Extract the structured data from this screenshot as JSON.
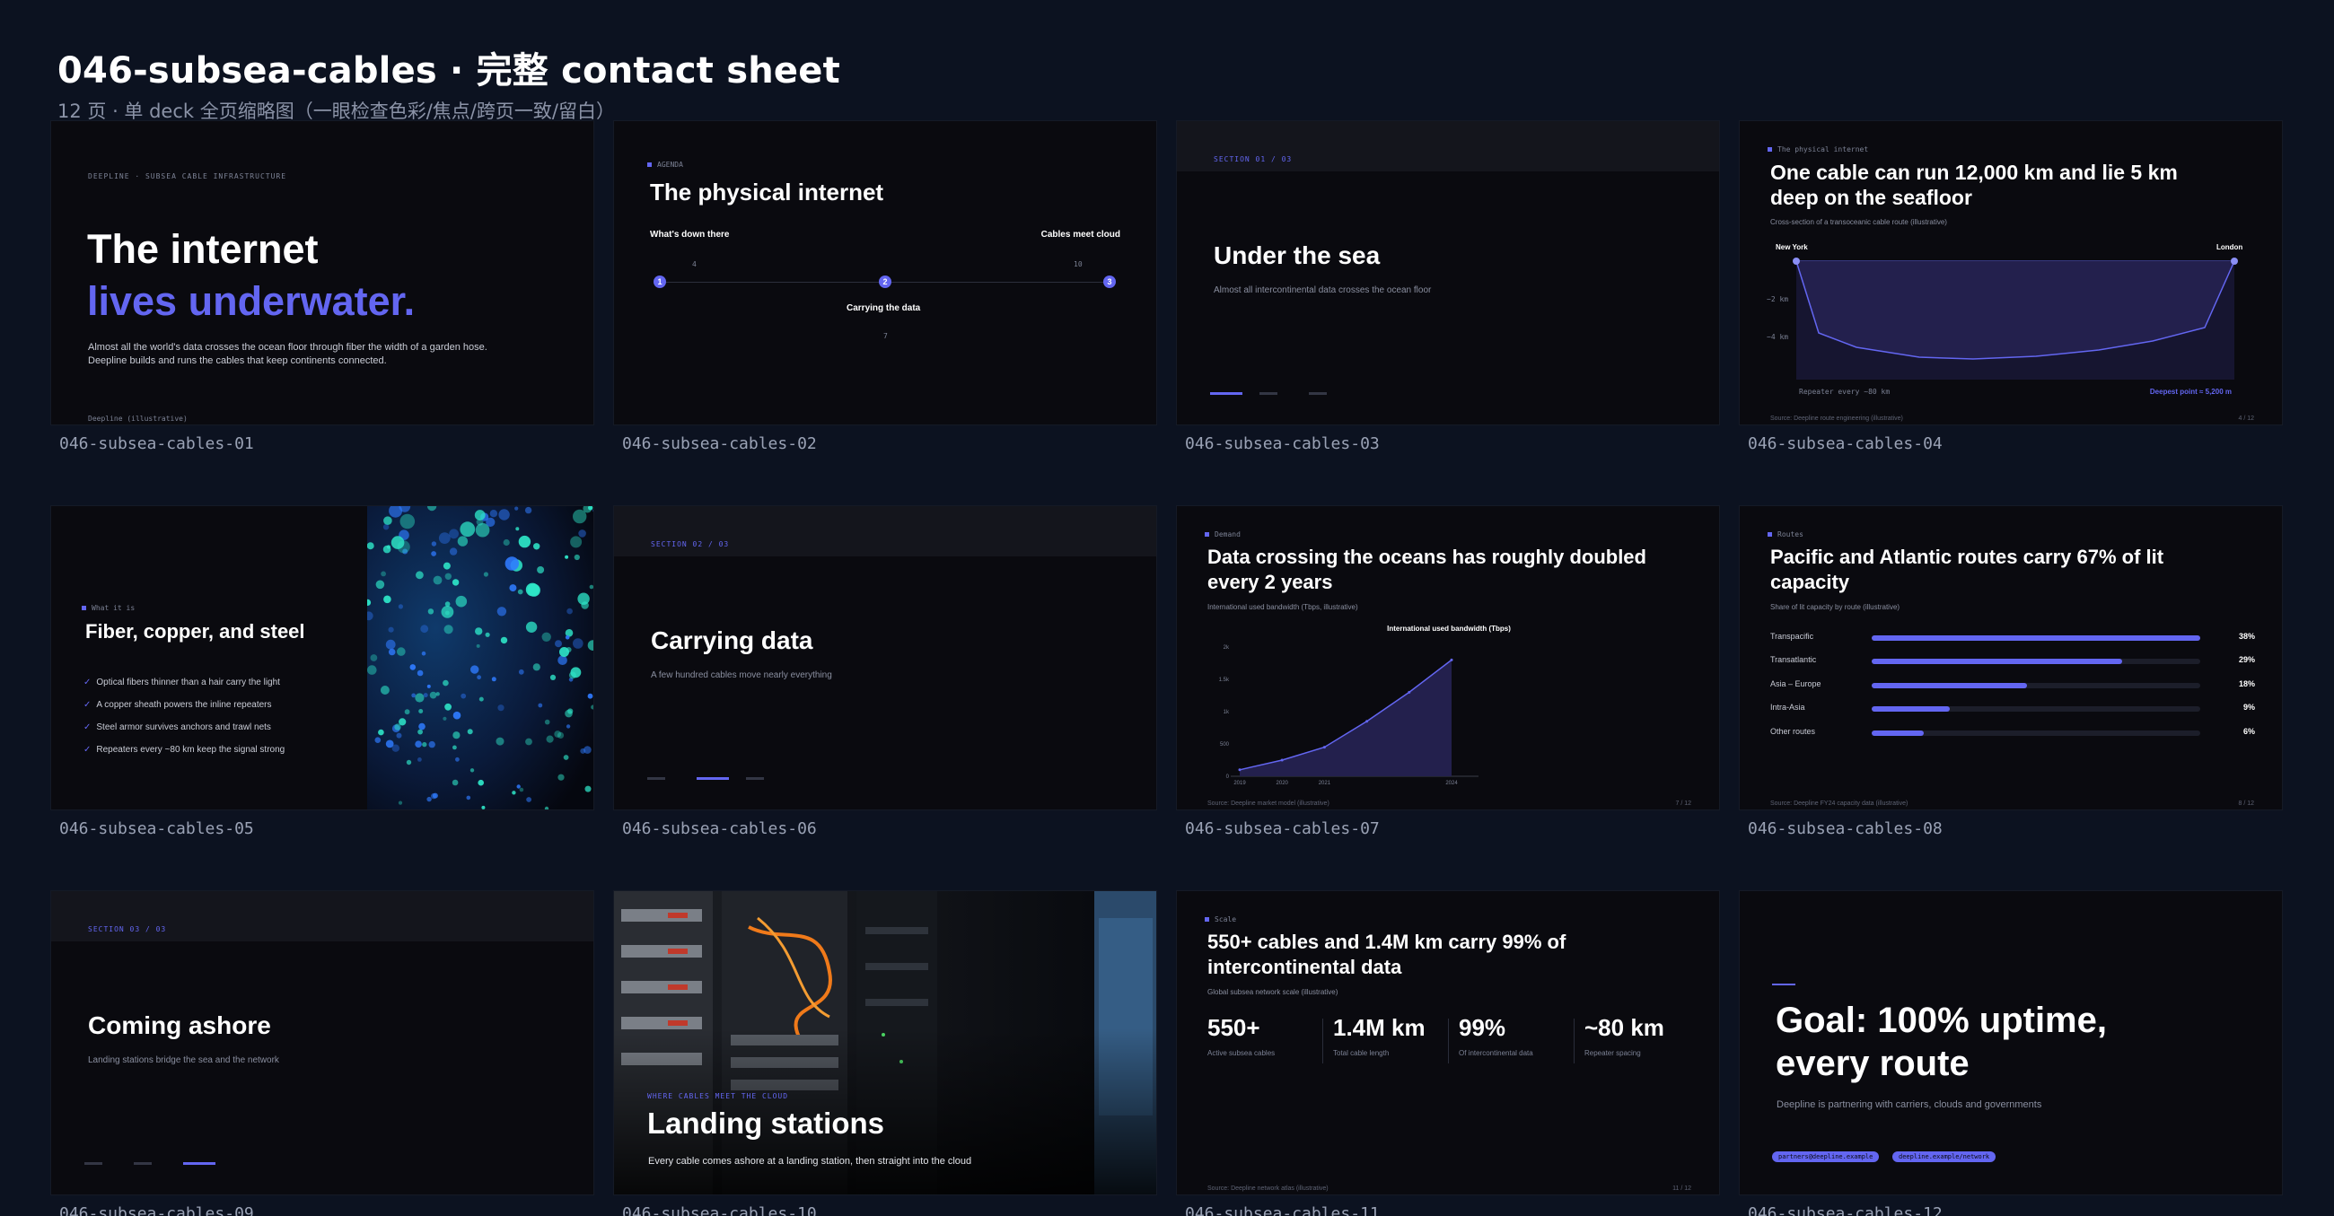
{
  "header": {
    "title": "046-subsea-cables · 完整 contact sheet",
    "subtitle": "12 页 · 单 deck 全页缩略图（一眼检查色彩/焦点/跨页一致/留白）"
  },
  "captions": [
    "046-subsea-cables-01",
    "046-subsea-cables-02",
    "046-subsea-cables-03",
    "046-subsea-cables-04",
    "046-subsea-cables-05",
    "046-subsea-cables-06",
    "046-subsea-cables-07",
    "046-subsea-cables-08",
    "046-subsea-cables-09",
    "046-subsea-cables-10",
    "046-subsea-cables-11",
    "046-subsea-cables-12"
  ],
  "s1": {
    "kicker": "DEEPLINE · SUBSEA CABLE INFRASTRUCTURE",
    "title_line1": "The internet",
    "title_line2": "lives underwater.",
    "body1": "Almost all the world's data crosses the ocean floor through fiber the width of a garden hose.",
    "body2": "Deepline builds and runs the cables that keep continents connected.",
    "footer": "Deepline (illustrative)"
  },
  "s2": {
    "kicker": "AGENDA",
    "title": "The physical internet",
    "left": "What's down there",
    "right": "Cables meet cloud",
    "middle": "Carrying the data",
    "n1": "1",
    "n2": "2",
    "n3": "3",
    "p1": "4",
    "p2": "7",
    "p3": "10"
  },
  "s3": {
    "kicker": "SECTION 01 / 03",
    "title": "Under the sea",
    "sub": "Almost all intercontinental data crosses the ocean floor"
  },
  "s4": {
    "kicker": "The physical internet",
    "title_line1": "One cable can run 12,000 km and lie 5 km",
    "title_line2": "deep on the seafloor",
    "sub": "Cross-section of a transoceanic cable route (illustrative)",
    "left_label": "New York",
    "right_label": "London",
    "y1": "−2 km",
    "y2": "−4 km",
    "note_left": "Repeater every ~80 km",
    "note_right": "Deepest point ≈ 5,200 m",
    "source": "Source: Deepline route engineering (illustrative)",
    "page": "4 / 12"
  },
  "s5": {
    "kicker": "What it is",
    "title": "Fiber, copper, and steel",
    "checks": [
      "Optical fibers thinner than a hair carry the light",
      "A copper sheath powers the inline repeaters",
      "Steel armor survives anchors and trawl nets",
      "Repeaters every ~80 km keep the signal strong"
    ],
    "check_icon": "✓"
  },
  "s6": {
    "kicker": "SECTION 02 / 03",
    "title": "Carrying data",
    "sub": "A few hundred cables move nearly everything"
  },
  "s7": {
    "kicker": "Demand",
    "title_line1": "Data crossing the oceans has roughly doubled",
    "title_line2": "every 2 years",
    "sub": "International used bandwidth (Tbps, illustrative)",
    "source": "Source: Deepline market model (illustrative)",
    "page": "7 / 12"
  },
  "chart_data": {
    "type": "area",
    "title": "International used bandwidth (Tbps)",
    "x": [
      "2019",
      "2020",
      "2021",
      "2022",
      "2023",
      "2024"
    ],
    "xticks": [
      "2019",
      "2020",
      "2021",
      "2024"
    ],
    "yticks": [
      "0",
      "500",
      "1k",
      "1.5k",
      "2k"
    ],
    "ylim": [
      0,
      2000
    ],
    "values": [
      100,
      250,
      450,
      850,
      1300,
      1800
    ]
  },
  "s8": {
    "kicker": "Routes",
    "title_line1": "Pacific and Atlantic routes carry 67% of lit",
    "title_line2": "capacity",
    "sub": "Share of lit capacity by route (illustrative)",
    "bars": [
      {
        "label": "Transpacific",
        "value": "38%",
        "pct": 38
      },
      {
        "label": "Transatlantic",
        "value": "29%",
        "pct": 29
      },
      {
        "label": "Asia – Europe",
        "value": "18%",
        "pct": 18
      },
      {
        "label": "Intra-Asia",
        "value": "9%",
        "pct": 9
      },
      {
        "label": "Other routes",
        "value": "6%",
        "pct": 6
      }
    ],
    "bar_scale_max": 38,
    "source": "Source: Deepline FY24 capacity data (illustrative)",
    "page": "8 / 12"
  },
  "s9": {
    "kicker": "SECTION 03 / 03",
    "title": "Coming ashore",
    "sub": "Landing stations bridge the sea and the network"
  },
  "s10": {
    "kicker": "WHERE CABLES MEET THE CLOUD",
    "title": "Landing stations",
    "sub": "Every cable comes ashore at a landing station, then straight into the cloud"
  },
  "s11": {
    "kicker": "Scale",
    "title_line1": "550+ cables and 1.4M km carry 99% of",
    "title_line2": "intercontinental data",
    "sub": "Global subsea network scale (illustrative)",
    "stats": [
      {
        "value": "550+",
        "label": "Active subsea cables"
      },
      {
        "value": "1.4M km",
        "label": "Total cable length"
      },
      {
        "value": "99%",
        "label": "Of intercontinental data"
      },
      {
        "value": "~80 km",
        "label": "Repeater spacing"
      }
    ],
    "source": "Source: Deepline network atlas (illustrative)",
    "page": "11 / 12"
  },
  "s12": {
    "title_line1": "Goal: 100% uptime,",
    "title_line2": "every route",
    "sub": "Deepline is partnering with carriers, clouds and governments",
    "pill1": "partners@deepline.example",
    "pill2": "deepline.example/network"
  },
  "colors": {
    "accent": "#6366f1",
    "background": "#0c1220",
    "slide_bg": "#0a0a0f"
  }
}
